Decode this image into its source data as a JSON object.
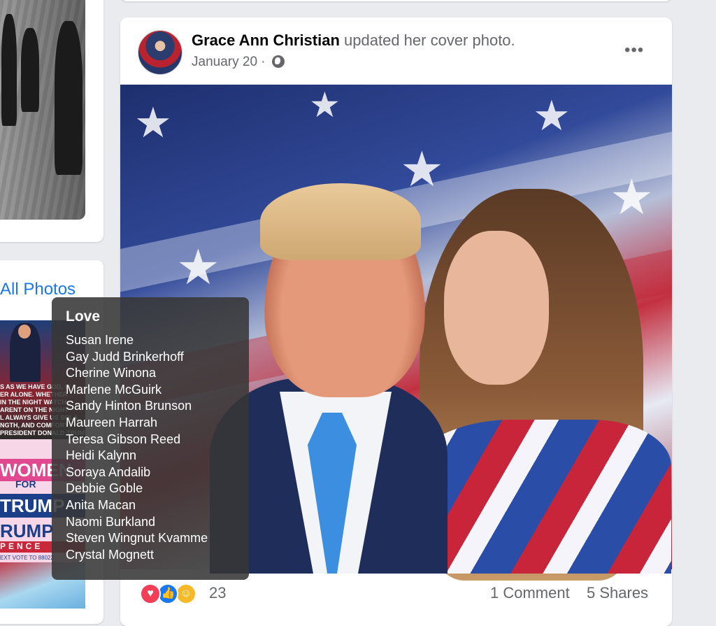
{
  "left_panel": {
    "all_photos_label": "All Photos",
    "thumb_quote": "S AS WE HAVE GOD, W\nER ALONE. WHETHER\nIN THE NIGHT WATCH\nARENT ON THE NIGHT\nL ALWAYS GIVE US SOLA\nNGTH, AND COMFORT\nPRESIDENT DONALD TRUM",
    "thumb_women": "WOMEN",
    "thumb_for": "FOR",
    "thumb_trump": "TRUMP",
    "thumb_trump2": "RUMP",
    "thumb_pence": "PENCE",
    "thumb_vote": "EXT VOTE TO 88022"
  },
  "post": {
    "author": "Grace Ann Christian",
    "action": "updated her cover photo.",
    "date": "January 20",
    "separator": "·",
    "more_label": "•••",
    "reaction_count": "23",
    "comments_label": "1 Comment",
    "shares_label": "5 Shares"
  },
  "tooltip": {
    "title": "Love",
    "names": [
      "Susan Irene",
      "Gay Judd Brinkerhoff",
      "Cherine Winona",
      "Marlene McGuirk",
      "Sandy Hinton Brunson",
      "Maureen Harrah",
      "Teresa Gibson Reed",
      "Heidi Kalynn",
      "Soraya Andalib",
      "Debbie Goble",
      "Anita Macan",
      "Naomi Burkland",
      "Steven Wingnut Kvamme",
      "Crystal Mognett"
    ]
  },
  "reactions": {
    "icons": [
      "love-icon",
      "like-icon",
      "care-icon"
    ],
    "love_color": "#f33e58",
    "like_color": "#1877f2",
    "care_color": "#f7b928"
  },
  "colors": {
    "page_background": "#e9ebee",
    "card_background": "#ffffff",
    "link_blue": "#1877f2",
    "secondary_text": "#65676b"
  }
}
